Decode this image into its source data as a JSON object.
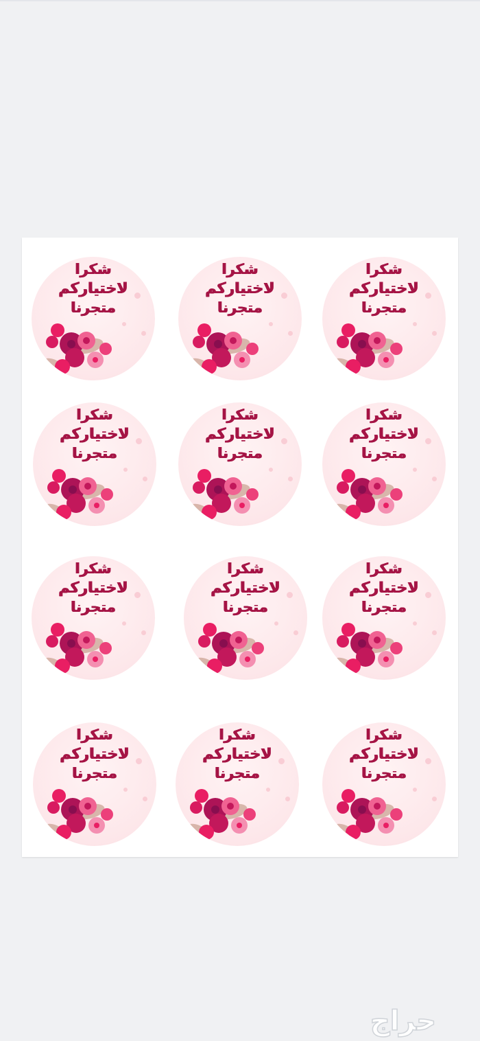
{
  "sticker": {
    "line1": "شكرا",
    "line2": "لاختياركم",
    "line3": "متجرنا"
  },
  "sticker_count": 12,
  "colors": {
    "page_background": "#f0f1f3",
    "sheet": "#ffffff",
    "sticker_background": "#fde7ea",
    "sticker_text": "#a51445",
    "flowers": "#d81b60"
  },
  "watermark": {
    "text": "حراج"
  }
}
